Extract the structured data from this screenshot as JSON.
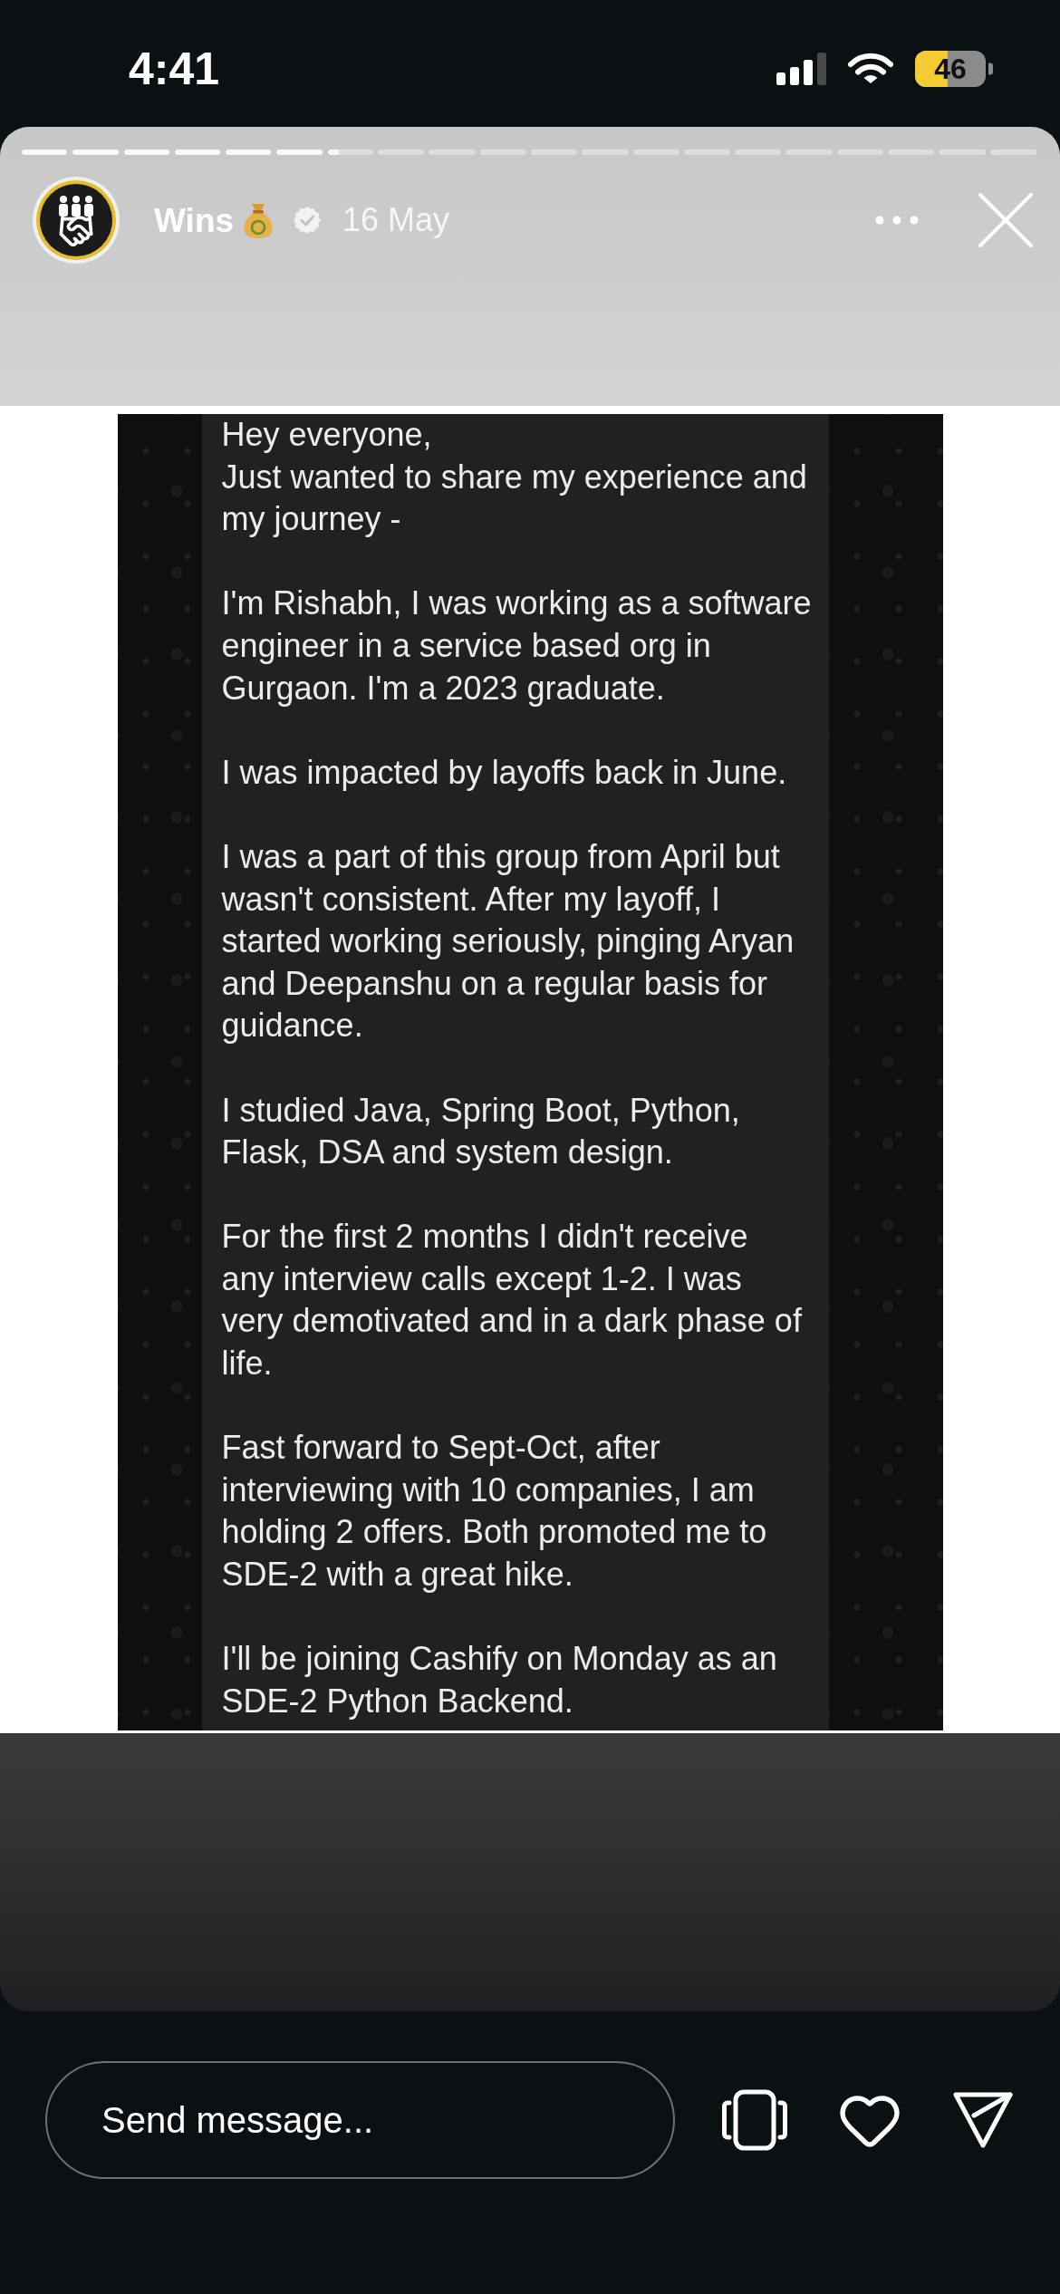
{
  "status_bar": {
    "time": "4:41",
    "battery": "46"
  },
  "story": {
    "progress": [
      {
        "level": 1
      },
      {
        "level": 1
      },
      {
        "level": 1
      },
      {
        "level": 1
      },
      {
        "level": 1
      },
      {
        "level": 1
      },
      {
        "level": 0.25
      },
      {
        "level": 0
      },
      {
        "level": 0
      },
      {
        "level": 0
      },
      {
        "level": 0
      },
      {
        "level": 0
      },
      {
        "level": 0
      },
      {
        "level": 0
      },
      {
        "level": 0
      },
      {
        "level": 0
      },
      {
        "level": 0
      },
      {
        "level": 0
      },
      {
        "level": 0
      },
      {
        "level": 0
      }
    ],
    "account": "Wins",
    "verified": true,
    "date": "16 May"
  },
  "post": {
    "paragraphs": [
      {
        "lines": [
          "Hey everyone,",
          "Just wanted to share my experience and",
          "my journey -"
        ]
      },
      {
        "lines": [
          "I'm Rishabh, I was working as a software",
          "engineer in a service based org in",
          "Gurgaon. I'm a 2023 graduate."
        ]
      },
      {
        "lines": [
          "I was impacted by layoffs back in June."
        ]
      },
      {
        "lines": [
          "I was a part of this group from April but",
          "wasn't consistent. After my layoff, I",
          "started working seriously, pinging Aryan",
          "and Deepanshu on a regular basis for",
          "guidance."
        ]
      },
      {
        "lines": [
          "I studied Java, Spring Boot, Python,",
          "Flask, DSA and system design."
        ]
      },
      {
        "lines": [
          "For the first 2 months I didn't receive",
          "any interview calls except 1-2. I was",
          "very demotivated and in a dark phase of",
          "life."
        ]
      },
      {
        "lines": [
          "Fast forward to Sept-Oct, after",
          "interviewing with 10 companies, I am",
          "holding 2 offers. Both promoted me to",
          "SDE-2 with a great hike."
        ]
      },
      {
        "lines": [
          "I'll be joining Cashify on Monday as an",
          "SDE-2 Python Backend."
        ]
      }
    ]
  },
  "reply_bar": {
    "placeholder": "Send message..."
  }
}
